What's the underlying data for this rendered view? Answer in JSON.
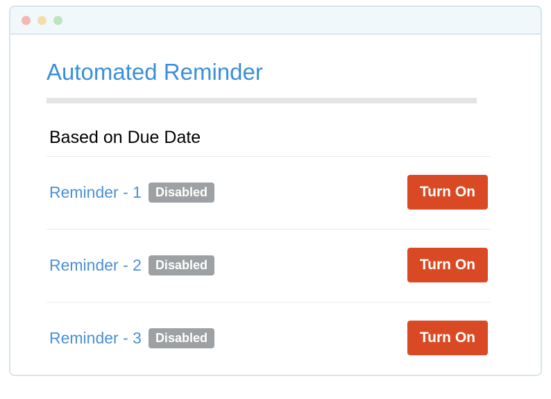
{
  "header": {
    "title": "Automated Reminder"
  },
  "section": {
    "title": "Based on Due Date"
  },
  "reminders": [
    {
      "name": "Reminder - 1",
      "status": "Disabled",
      "action": "Turn On"
    },
    {
      "name": "Reminder - 2",
      "status": "Disabled",
      "action": "Turn On"
    },
    {
      "name": "Reminder - 3",
      "status": "Disabled",
      "action": "Turn On"
    }
  ]
}
